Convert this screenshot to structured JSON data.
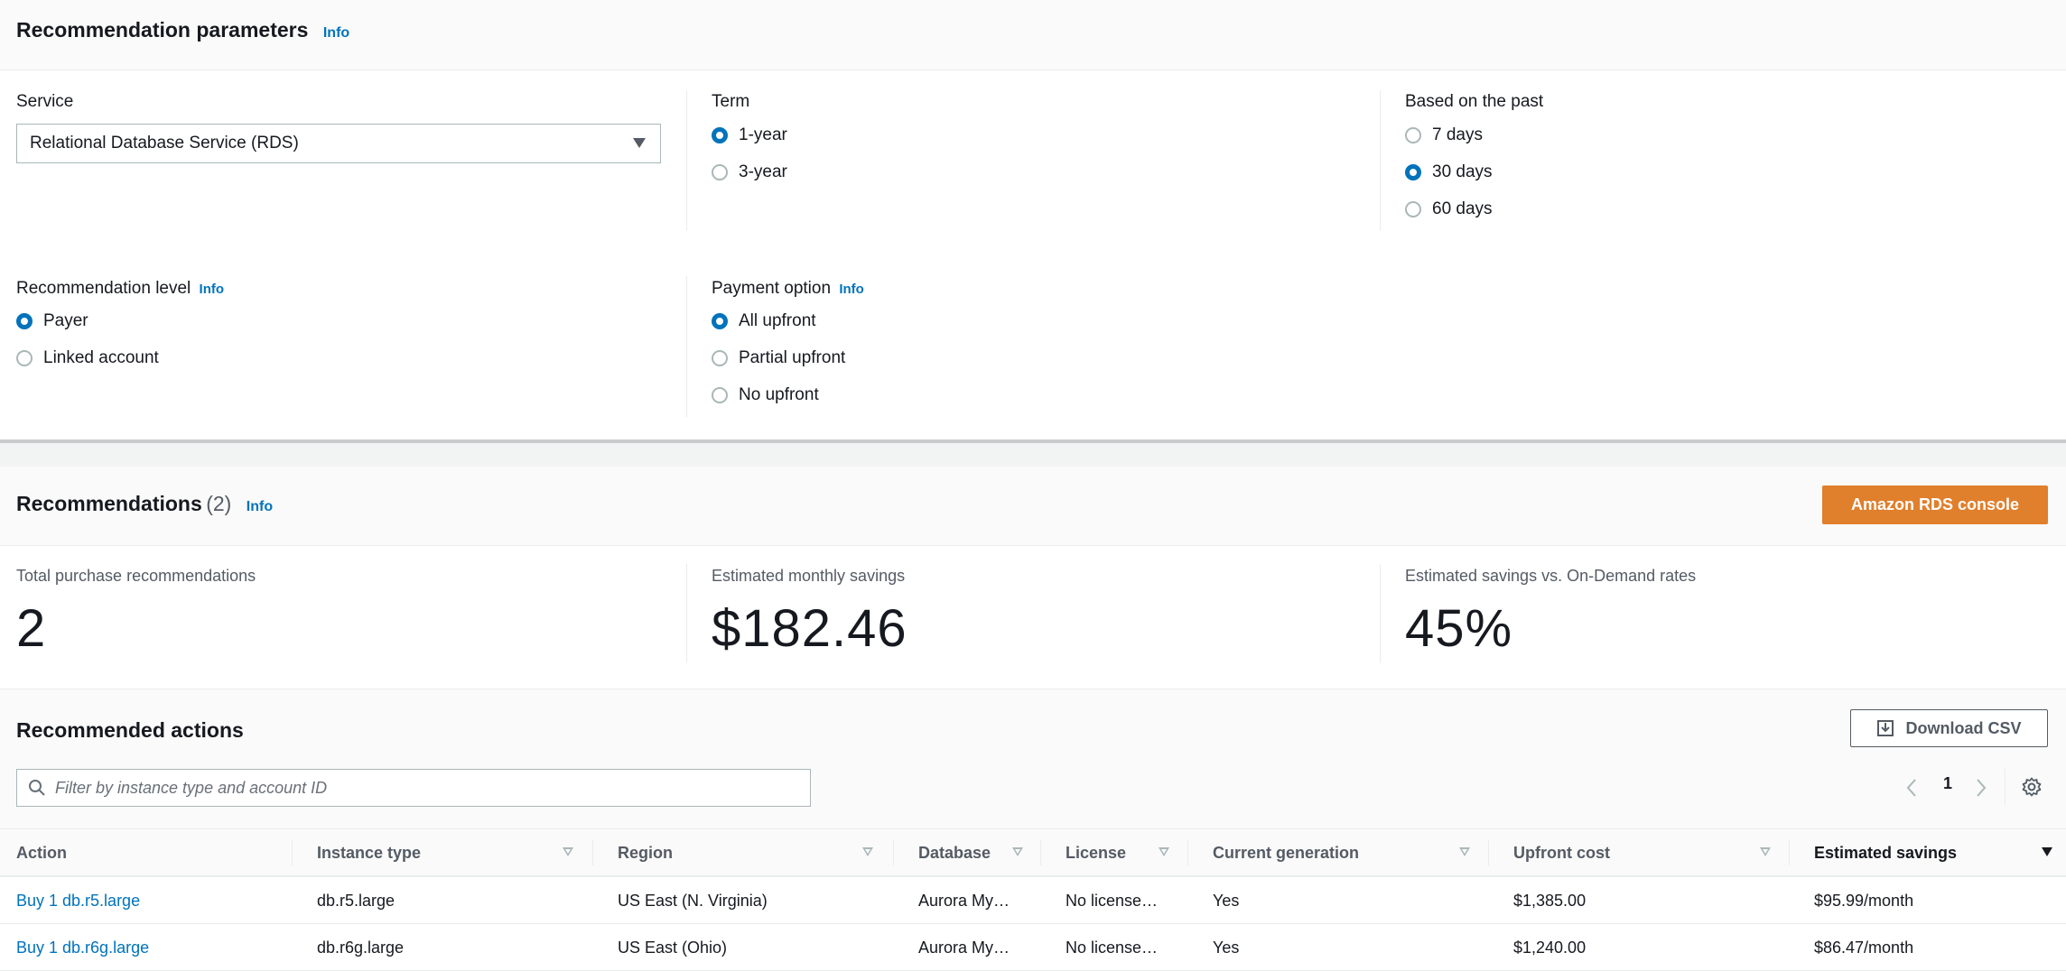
{
  "parameters": {
    "title": "Recommendation parameters",
    "info": "Info",
    "service": {
      "label": "Service",
      "value": "Relational Database Service (RDS)"
    },
    "term": {
      "label": "Term",
      "options": [
        {
          "label": "1-year",
          "selected": true
        },
        {
          "label": "3-year",
          "selected": false
        }
      ]
    },
    "based_on": {
      "label": "Based on the past",
      "options": [
        {
          "label": "7 days",
          "selected": false
        },
        {
          "label": "30 days",
          "selected": true
        },
        {
          "label": "60 days",
          "selected": false
        }
      ]
    },
    "recommendation_level": {
      "label": "Recommendation level",
      "info": "Info",
      "options": [
        {
          "label": "Payer",
          "selected": true
        },
        {
          "label": "Linked account",
          "selected": false
        }
      ]
    },
    "payment_option": {
      "label": "Payment option",
      "info": "Info",
      "options": [
        {
          "label": "All upfront",
          "selected": true
        },
        {
          "label": "Partial upfront",
          "selected": false
        },
        {
          "label": "No upfront",
          "selected": false
        }
      ]
    }
  },
  "recommendations": {
    "title": "Recommendations",
    "count": "(2)",
    "info": "Info",
    "console_button": "Amazon RDS console",
    "metrics": [
      {
        "label": "Total purchase recommendations",
        "value": "2"
      },
      {
        "label": "Estimated monthly savings",
        "value": "$182.46"
      },
      {
        "label": "Estimated savings vs. On-Demand rates",
        "value": "45%"
      }
    ]
  },
  "actions": {
    "title": "Recommended actions",
    "download_button": "Download CSV",
    "filter_placeholder": "Filter by instance type and account ID",
    "page": "1",
    "columns": [
      "Action",
      "Instance type",
      "Region",
      "Database",
      "License",
      "Current generation",
      "Upfront cost",
      "Estimated savings"
    ],
    "rows": [
      {
        "action": "Buy 1 db.r5.large",
        "instance_type": "db.r5.large",
        "region": "US East (N. Virginia)",
        "database": "Aurora My…",
        "license": "No license…",
        "current_generation": "Yes",
        "upfront_cost": "$1,385.00",
        "estimated_savings": "$95.99/month"
      },
      {
        "action": "Buy 1 db.r6g.large",
        "instance_type": "db.r6g.large",
        "region": "US East (Ohio)",
        "database": "Aurora My…",
        "license": "No license…",
        "current_generation": "Yes",
        "upfront_cost": "$1,240.00",
        "estimated_savings": "$86.47/month"
      }
    ]
  },
  "colors": {
    "link": "#0073bb",
    "primary_button": "#e07f2c",
    "radio_selected": "#0073bb"
  }
}
